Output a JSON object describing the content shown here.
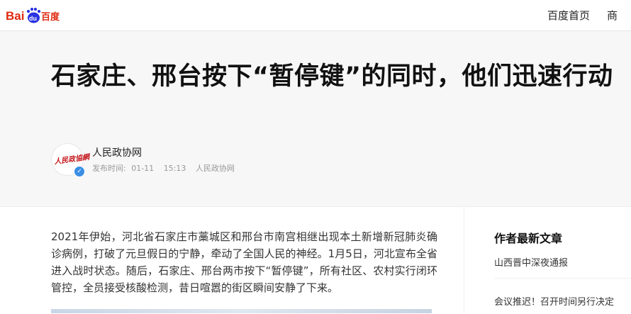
{
  "topbar": {
    "logo_text_left": "Bai",
    "logo_text_mid": "du",
    "logo_text_right": "百度",
    "nav_home": "百度首页",
    "nav_cut": "商"
  },
  "article": {
    "title": "石家庄、邢台按下“暂停键”的同时，他们迅速行动",
    "author": {
      "name": "人民政协网",
      "avatar_text": "人民政協網",
      "publish_label": "发布时间:",
      "publish_date": "01-11",
      "publish_time": "15:13",
      "source": "人民政协网"
    },
    "paragraph": "2021年伊始，河北省石家庄市藁城区和邢台市南宫相继出现本土新增新冠肺炎确诊病例，打破了元旦假日的宁静，牵动了全国人民的神经。1月5日，河北宣布全省进入战时状态。随后，石家庄、邢台两市按下“暂停键”，所有社区、农村实行闭环管控，全员接受核酸检测，昔日喧嚣的街区瞬间安静了下来。"
  },
  "sidebar": {
    "title": "作者最新文章",
    "links": [
      "山西晋中深夜通报",
      "会议推迟！召开时间另行决定"
    ]
  },
  "colors": {
    "baidu_red": "#de2910",
    "baidu_blue": "#2932e1",
    "verified_blue": "#3a8ee6",
    "header_bg": "#f7f7f7"
  }
}
